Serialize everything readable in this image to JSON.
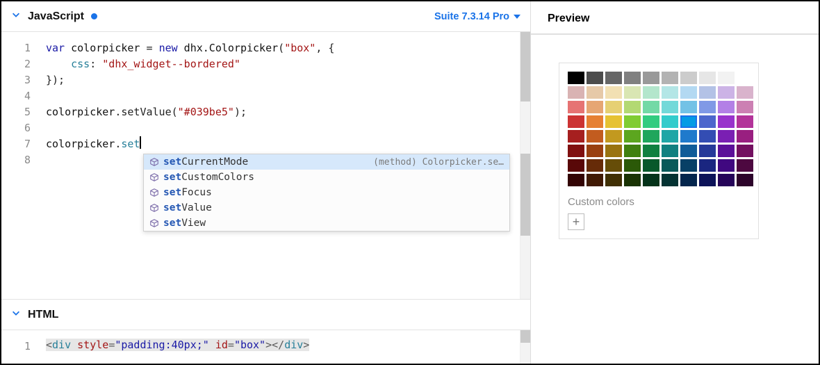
{
  "panels": {
    "js": {
      "title": "JavaScript",
      "modified": true,
      "version_label": "Suite 7.3.14 Pro",
      "line_numbers": [
        "1",
        "2",
        "3",
        "4",
        "5",
        "6",
        "7",
        "8"
      ],
      "code": {
        "l1_var": "var",
        "l1_name": " colorpicker ",
        "l1_eq": "= ",
        "l1_new": "new",
        "l1_ctor": " dhx.Colorpicker",
        "l1_str": "\"box\"",
        "l2_key": "css",
        "l2_str": "\"dhx_widget--bordered\"",
        "l3": "});",
        "l5_obj": "colorpicker",
        "l5_m": ".setValue(",
        "l5_str": "\"#039be5\"",
        "l5_end": ");",
        "l7_obj": "colorpicker",
        "l7_dot": ".",
        "l7_typed": "set"
      }
    },
    "html": {
      "title": "HTML",
      "line_numbers": [
        "1"
      ],
      "code": {
        "tag_open": "div",
        "attr_style": "style",
        "val_style": "\"padding:40px;\"",
        "attr_id": "id",
        "val_id": "\"box\"",
        "tag_close": "div"
      }
    },
    "preview_title": "Preview"
  },
  "autocomplete": {
    "selected_hint": "(method) Colorpicker.se…",
    "items": [
      {
        "match": "set",
        "rest": "CurrentMode",
        "selected": true
      },
      {
        "match": "set",
        "rest": "CustomColors",
        "selected": false
      },
      {
        "match": "set",
        "rest": "Focus",
        "selected": false
      },
      {
        "match": "set",
        "rest": "Value",
        "selected": false
      },
      {
        "match": "set",
        "rest": "View",
        "selected": false
      }
    ]
  },
  "colorpicker": {
    "custom_label": "Custom colors",
    "selected": "#039be5",
    "palette": [
      [
        "#000000",
        "#4c4c4c",
        "#666666",
        "#808080",
        "#999999",
        "#b3b3b3",
        "#cccccc",
        "#e6e6e6",
        "#f2f2f2",
        "#ffffff"
      ],
      [
        "#d9b3b3",
        "#e6c9a8",
        "#f2e0b3",
        "#d9e6b3",
        "#b3e6cc",
        "#b3e6e6",
        "#b3d9f2",
        "#b3c2e6",
        "#ccb3e6",
        "#d9b3cc"
      ],
      [
        "#e67373",
        "#e6a673",
        "#e6d073",
        "#b3d973",
        "#73d9a6",
        "#73d9d9",
        "#73c2e6",
        "#8099e6",
        "#b380e6",
        "#cc80b3"
      ],
      [
        "#cc3333",
        "#e68033",
        "#e6c233",
        "#80cc33",
        "#33cc80",
        "#33cccc",
        "#039be5",
        "#4d66cc",
        "#9933cc",
        "#b33399"
      ],
      [
        "#a61f1f",
        "#c25c1f",
        "#c2991f",
        "#5ca61f",
        "#1fa65c",
        "#1fa6a6",
        "#1f7acc",
        "#334db3",
        "#7a1fb3",
        "#991f80"
      ],
      [
        "#801010",
        "#994010",
        "#997310",
        "#408010",
        "#108040",
        "#108080",
        "#105c99",
        "#263999",
        "#5c1099",
        "#731060"
      ],
      [
        "#590808",
        "#662b08",
        "#664d08",
        "#2b5908",
        "#08592b",
        "#085959",
        "#084066",
        "#1a2680",
        "#400880",
        "#4d0840"
      ],
      [
        "#330404",
        "#401a04",
        "#403004",
        "#1a3304",
        "#04331a",
        "#043333",
        "#04264d",
        "#0d1359",
        "#260459",
        "#2d042b"
      ]
    ]
  }
}
